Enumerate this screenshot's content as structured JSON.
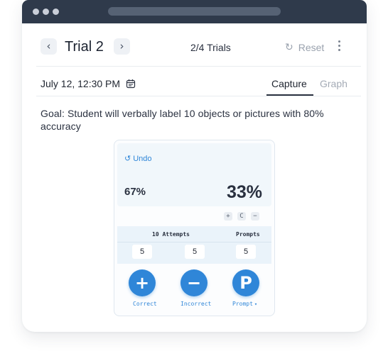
{
  "window": {
    "dots": [
      "window-dot-1",
      "window-dot-2",
      "window-dot-3"
    ]
  },
  "header": {
    "prev_icon": "chevron-left-icon",
    "next_icon": "chevron-right-icon",
    "prev_glyph": "‹",
    "next_glyph": "›",
    "title": "Trial 2",
    "trial_count": "2/4 Trials",
    "reset_label": "Reset",
    "reset_icon": "refresh-icon",
    "reset_glyph": "↻",
    "menu_icon": "more-vertical-icon"
  },
  "subheader": {
    "date": "July 12, 12:30 PM",
    "calendar_icon": "calendar-icon",
    "tabs": [
      {
        "label": "Capture",
        "active": true
      },
      {
        "label": "Graph",
        "active": false
      }
    ]
  },
  "goal": "Goal: Student will verbally label 10 objects or pictures with 80% accuracy",
  "card": {
    "undo_label": "Undo",
    "undo_icon": "undo-icon",
    "undo_glyph": "↺",
    "percent_left": "67%",
    "percent_right": "33%",
    "mini_buttons": [
      "+",
      "C",
      "−"
    ],
    "attempts_label": "10 Attempts",
    "prompts_label": "Prompts",
    "correct_count": "5",
    "incorrect_count": "5",
    "prompt_count": "5",
    "buttons": {
      "correct": {
        "glyph": "+",
        "label": "Correct",
        "icon": "plus-icon"
      },
      "incorrect": {
        "glyph": "−",
        "label": "Incorrect",
        "icon": "minus-icon"
      },
      "prompt": {
        "glyph": "P",
        "label": "Prompt",
        "icon": "prompt-icon",
        "caret": "▾"
      }
    }
  },
  "colors": {
    "accent": "#2f86d8",
    "titlebar": "#2f3a4b",
    "muted_text": "#9aa2ae"
  }
}
